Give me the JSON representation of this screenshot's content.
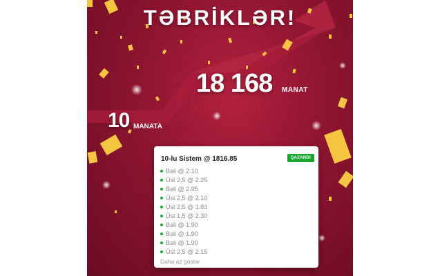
{
  "banner": {
    "title": "TƏBRİKLƏR!",
    "big_amount": "18 168",
    "big_currency": "MANAT",
    "small_amount": "10",
    "small_currency": "MANATA",
    "colors": {
      "background": "#8e1530",
      "confetti": "#f5c542",
      "win": "#1aa533"
    }
  },
  "card": {
    "title": "10-lu Sistem @ 1816.85",
    "status_badge": "QAZANDI",
    "selections": [
      "Bəli @ 2.10",
      "Üst 2,5 @ 2.25",
      "Bəli @ 2.95",
      "Üst 2,5 @ 2.10",
      "Üst 2,5 @ 1.83",
      "Üst 1,5 @ 2.30",
      "Bəli @ 1.90",
      "Bəli @ 1.90",
      "Bəli @ 1.90",
      "Üst 2,5 @ 2.15"
    ],
    "show_less": "Daha az göstər"
  }
}
